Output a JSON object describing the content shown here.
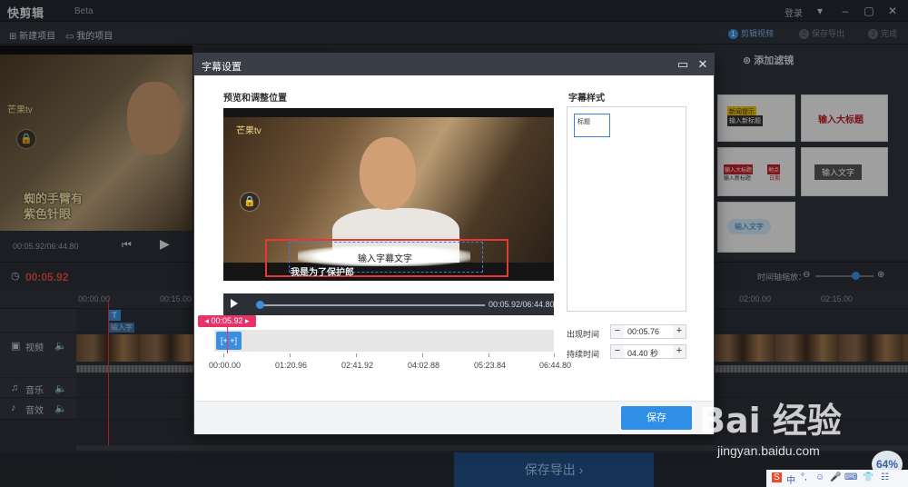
{
  "app": {
    "title": "快剪辑",
    "edition": "Beta",
    "login": "登录",
    "window_controls": [
      "▾",
      "–",
      "▢",
      "✕"
    ]
  },
  "toolbar": {
    "new_project": "新建项目",
    "my_projects": "我的项目",
    "steps": [
      {
        "num": "1",
        "label": "剪辑视频"
      },
      {
        "num": "2",
        "label": "保存导出"
      },
      {
        "num": "3",
        "label": "完成"
      }
    ]
  },
  "preview": {
    "logo_text": "芒果tv",
    "subtitle_line1": "蜘的手臂有",
    "subtitle_line2": "紫色针眼",
    "time": "00:05.92/06:44.80"
  },
  "right_panel": {
    "add_filter": "添加滤镜",
    "tiles": [
      "新闻提示",
      "输入新标题",
      "输入大标题",
      "输入大标题",
      "输入新标题",
      "地点",
      "日期",
      "输入文字",
      "输入文字"
    ]
  },
  "timeline": {
    "current_time": "00:05.92",
    "zoom_label": "时间轴缩放：",
    "ruler": [
      "00:00.00",
      "00:15.00",
      "02:00.00",
      "02:15.00"
    ],
    "text_clip": "输入字",
    "tracks": [
      {
        "name": "视频",
        "icon": "video-icon"
      },
      {
        "name": "音乐",
        "icon": "music-icon"
      },
      {
        "name": "音效",
        "icon": "sound-effect-icon"
      }
    ],
    "export_button": "保存导出"
  },
  "modal": {
    "title": "字幕设置",
    "preview_title": "预览和调整位置",
    "style_title": "字幕样式",
    "video_logo": "芒果tv",
    "subtitle_placeholder": "输入字幕文字",
    "burned_subtitle": "我是为了保护郎",
    "video_time": "00:05.92/06:44.80",
    "time_tag": "00:05.92",
    "clip_label": "[+ +]",
    "scale": [
      "00:00.00",
      "01:20.96",
      "02:41.92",
      "04:02.88",
      "05:23.84",
      "06:44.80"
    ],
    "style_item": "标题",
    "appear_label": "出现时间",
    "appear_value": "00:05.76",
    "duration_label": "持续时间",
    "duration_value": "04.40 秒",
    "save_button": "保存"
  },
  "watermark": {
    "brand": "Bai  经验",
    "url": "jingyan.baidu.com",
    "badge": "64%",
    "ime_items": [
      "S",
      "中",
      "°,",
      "☺",
      "🎤",
      "⌨",
      "👕",
      "☷"
    ]
  }
}
